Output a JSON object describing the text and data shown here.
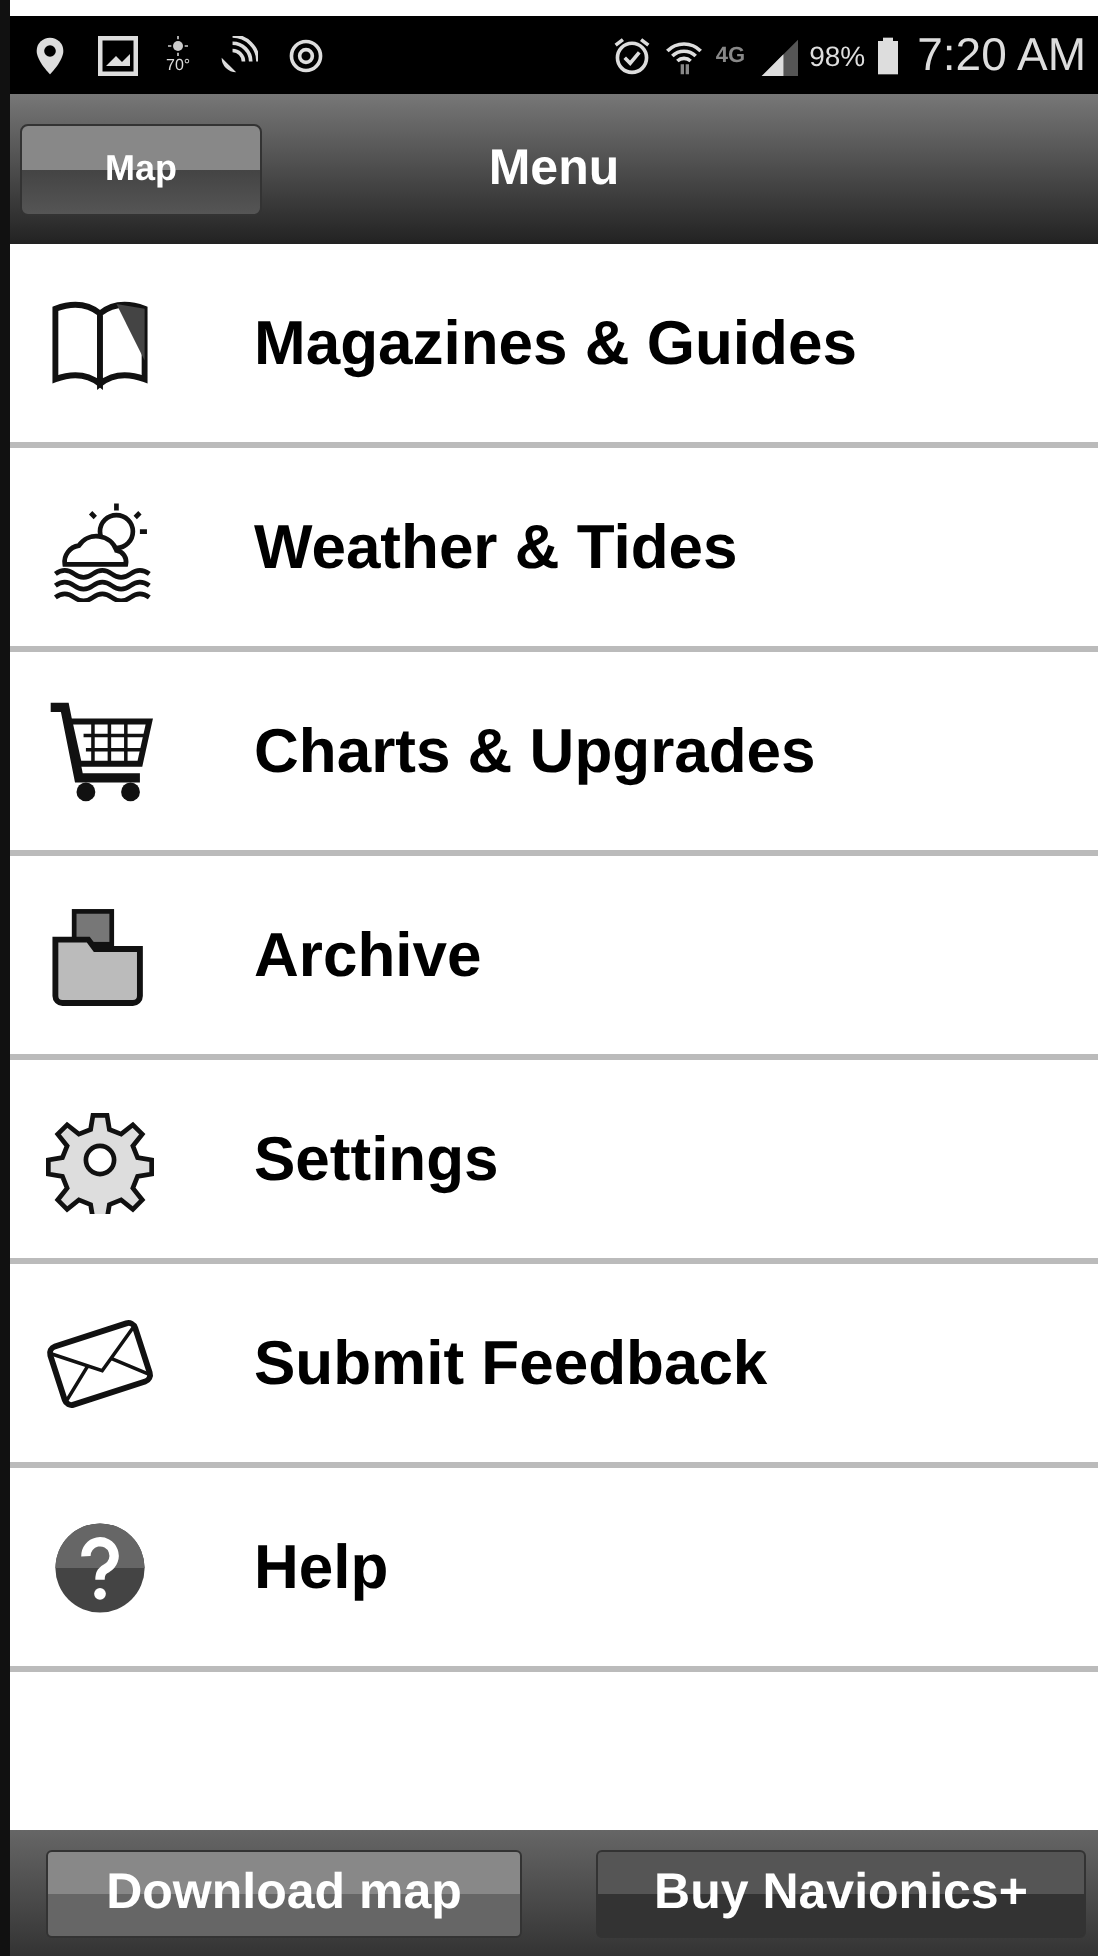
{
  "status_bar": {
    "temperature": "70°",
    "network": "4G",
    "battery": "98%",
    "time": "7:20 AM"
  },
  "header": {
    "back_button": "Map",
    "title": "Menu"
  },
  "menu": [
    {
      "label": "Magazines & Guides",
      "kind": "book"
    },
    {
      "label": "Weather & Tides",
      "kind": "weather"
    },
    {
      "label": "Charts & Upgrades",
      "kind": "cart"
    },
    {
      "label": "Archive",
      "kind": "folder"
    },
    {
      "label": "Settings",
      "kind": "gear"
    },
    {
      "label": "Submit Feedback",
      "kind": "envelope"
    },
    {
      "label": "Help",
      "kind": "help"
    }
  ],
  "footer": {
    "buttons": [
      "Download map",
      "Buy Navionics+"
    ]
  }
}
